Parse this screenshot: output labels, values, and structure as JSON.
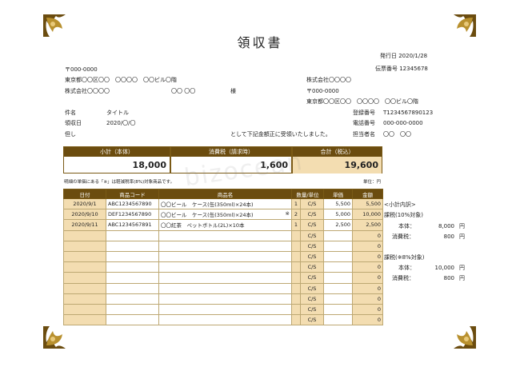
{
  "doc": {
    "title": "領収書",
    "issue_date": "発行日 2020/1/28",
    "slip_no": "伝票番号 12345678",
    "to_zip": "〒000-0000",
    "to_addr": "東京都〇〇区〇〇　〇〇〇〇　〇〇ビル〇階",
    "to_company": "株式会社〇〇〇〇",
    "to_person": "〇〇 〇〇",
    "honorific": "様",
    "subject_label": "件名",
    "subject_value": "タイトル",
    "received_label": "領収日",
    "received_value": "2020/〇/〇",
    "note_label": "但し",
    "note_text": "として下記金額正に受領いたしました。",
    "from_company": "株式会社〇〇〇〇",
    "from_zip": "〒000-0000",
    "from_addr": "東京都〇〇区〇〇　〇〇〇〇　〇〇ビル〇階",
    "reg_label": "登録番号",
    "reg_value": "T1234567890123",
    "tel_label": "電話番号",
    "tel_value": "000-000-0000",
    "staff_label": "担当者名",
    "staff_value": "〇〇　〇〇",
    "watermark": "bizocean"
  },
  "summary": {
    "subtotal_label": "小計（本体）",
    "subtotal_value": "18,000",
    "tax_label": "消費税（請求時）",
    "tax_value": "1,600",
    "total_label": "合計（税込）",
    "total_value": "19,600"
  },
  "table": {
    "note": "明細の単価にある「※」は軽減税率(8%)対象商品です。",
    "unit": "単位：円",
    "headers": [
      "日付",
      "商品コード",
      "商品名",
      "数量/単位",
      "単価",
      "金額"
    ],
    "rows": [
      {
        "date": "2020/9/1",
        "code": "ABC1234567890",
        "name": "〇〇ビール　ケース(缶(350ml)×24本)",
        "mark": "",
        "qty": "1",
        "unit": "C/S",
        "price": "5,500",
        "amount": "5,500"
      },
      {
        "date": "2020/9/10",
        "code": "DEF1234567890",
        "name": "〇〇ビール　ケース(缶(350ml)×24本)",
        "mark": "※",
        "qty": "2",
        "unit": "C/S",
        "price": "5,000",
        "amount": "10,000"
      },
      {
        "date": "2020/9/11",
        "code": "ABC1234567891",
        "name": "〇〇紅茶　ペットボトル(2L)×10本",
        "mark": "",
        "qty": "1",
        "unit": "C/S",
        "price": "2,500",
        "amount": "2,500"
      },
      {
        "date": "",
        "code": "",
        "name": "",
        "mark": "",
        "qty": "",
        "unit": "C/S",
        "price": "",
        "amount": "0"
      },
      {
        "date": "",
        "code": "",
        "name": "",
        "mark": "",
        "qty": "",
        "unit": "C/S",
        "price": "",
        "amount": "0"
      },
      {
        "date": "",
        "code": "",
        "name": "",
        "mark": "",
        "qty": "",
        "unit": "C/S",
        "price": "",
        "amount": "0"
      },
      {
        "date": "",
        "code": "",
        "name": "",
        "mark": "",
        "qty": "",
        "unit": "C/S",
        "price": "",
        "amount": "0"
      },
      {
        "date": "",
        "code": "",
        "name": "",
        "mark": "",
        "qty": "",
        "unit": "C/S",
        "price": "",
        "amount": "0"
      },
      {
        "date": "",
        "code": "",
        "name": "",
        "mark": "",
        "qty": "",
        "unit": "C/S",
        "price": "",
        "amount": "0"
      },
      {
        "date": "",
        "code": "",
        "name": "",
        "mark": "",
        "qty": "",
        "unit": "C/S",
        "price": "",
        "amount": "0"
      },
      {
        "date": "",
        "code": "",
        "name": "",
        "mark": "",
        "qty": "",
        "unit": "C/S",
        "price": "",
        "amount": "0"
      },
      {
        "date": "",
        "code": "",
        "name": "",
        "mark": "",
        "qty": "",
        "unit": "C/S",
        "price": "",
        "amount": "0"
      }
    ]
  },
  "breakdown": {
    "title": "<小計内訳>",
    "std_label": "課税(10%対象)",
    "std_base_label": "本体：",
    "std_base_value": "8,000",
    "std_tax_label": "消費税：",
    "std_tax_value": "800",
    "red_label": "課税(※8%対象)",
    "red_base_label": "本体：",
    "red_base_value": "10,000",
    "red_tax_label": "消費税：",
    "red_tax_value": "800",
    "yen": "円"
  },
  "colors": {
    "header_brown": "#6b4c0f",
    "tan_fill": "#f3ddb1",
    "border_gold": "#bda873"
  }
}
